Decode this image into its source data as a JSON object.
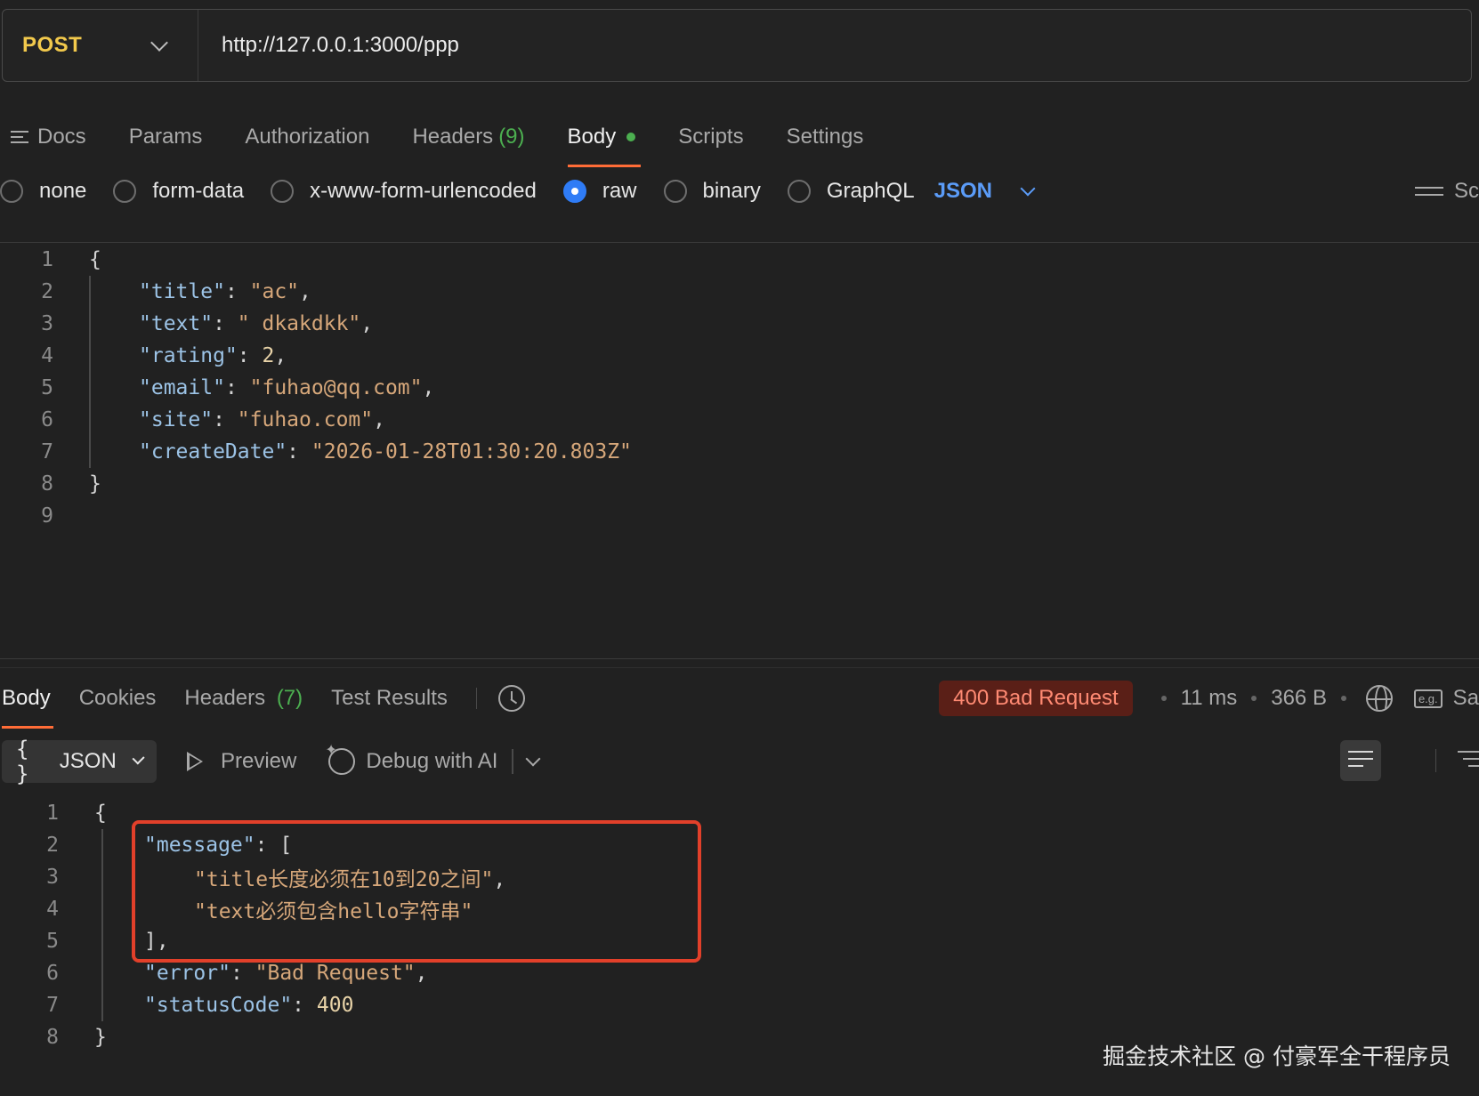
{
  "request": {
    "method": "POST",
    "url": "http://127.0.0.1:3000/ppp"
  },
  "request_tabs": [
    {
      "label": "Docs"
    },
    {
      "label": "Params"
    },
    {
      "label": "Authorization"
    },
    {
      "label": "Headers",
      "count": "(9)"
    },
    {
      "label": "Body",
      "active": true
    },
    {
      "label": "Scripts"
    },
    {
      "label": "Settings"
    }
  ],
  "body_types": {
    "options": [
      "none",
      "form-data",
      "x-www-form-urlencoded",
      "raw",
      "binary",
      "GraphQL"
    ],
    "selected": "raw",
    "format": "JSON",
    "right_label": "Sc"
  },
  "request_body_lines": [
    {
      "n": "1",
      "text": "{"
    },
    {
      "n": "2",
      "key": "\"title\"",
      "value": "\"ac\"",
      "tail": ","
    },
    {
      "n": "3",
      "key": "\"text\"",
      "value": "\" dkakdkk\"",
      "tail": ","
    },
    {
      "n": "4",
      "key": "\"rating\"",
      "num": "2",
      "tail": ","
    },
    {
      "n": "5",
      "key": "\"email\"",
      "value": "\"fuhao@qq.com\"",
      "tail": ","
    },
    {
      "n": "6",
      "key": "\"site\"",
      "value": "\"fuhao.com\"",
      "tail": ","
    },
    {
      "n": "7",
      "key": "\"createDate\"",
      "value": "\"2026-01-28T01:30:20.803Z\"",
      "tail": ""
    },
    {
      "n": "8",
      "text": "}"
    },
    {
      "n": "9",
      "text": ""
    }
  ],
  "response_tabs": [
    {
      "label": "Body",
      "active": true
    },
    {
      "label": "Cookies"
    },
    {
      "label": "Headers",
      "count": "(7)"
    },
    {
      "label": "Test Results"
    }
  ],
  "response_status": {
    "status": "400 Bad Request",
    "time": "11 ms",
    "size": "366 B",
    "eg_label": "e.g.",
    "save_label": "Sa"
  },
  "response_toolbar": {
    "format_braces": "{ }",
    "format": "JSON",
    "preview": "Preview",
    "debug": "Debug with AI"
  },
  "response_body_lines": [
    {
      "n": "1",
      "text": "{"
    },
    {
      "n": "2",
      "key": "\"message\"",
      "tail": ": ["
    },
    {
      "n": "3",
      "value": "\"title长度必须在10到20之间\"",
      "tail": ",",
      "deep": true
    },
    {
      "n": "4",
      "value": "\"text必须包含hello字符串\"",
      "tail": "",
      "deep": true
    },
    {
      "n": "5",
      "text": "],",
      "indent": true
    },
    {
      "n": "6",
      "key": "\"error\"",
      "value": "\"Bad Request\"",
      "tail": ","
    },
    {
      "n": "7",
      "key": "\"statusCode\"",
      "num": "400",
      "tail": ""
    },
    {
      "n": "8",
      "text": "}"
    }
  ],
  "watermark": "掘金技术社区 @ 付豪军全干程序员",
  "colors": {
    "accent": "#ff6c37",
    "method": "#f2c94c",
    "radio_selected": "#2f7cf6",
    "error_badge_bg": "#5a1f17",
    "error_badge_text": "#ff8a73",
    "highlight_box": "#e2402a"
  }
}
